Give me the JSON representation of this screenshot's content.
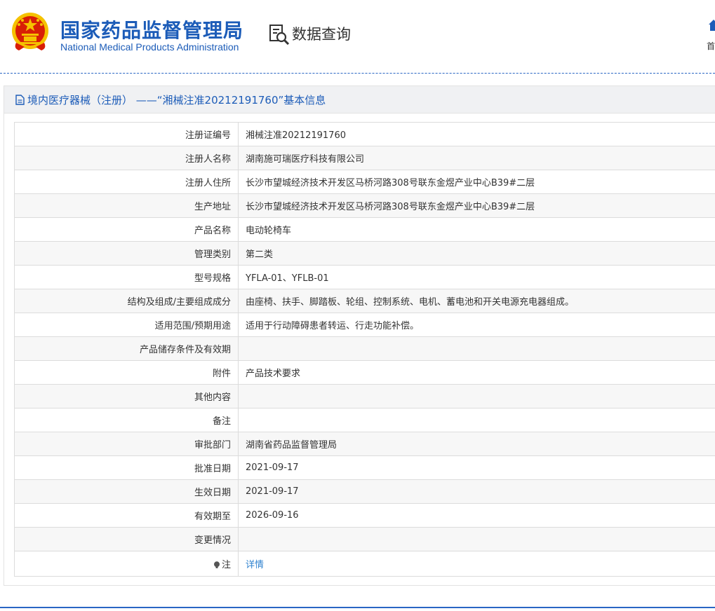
{
  "header": {
    "org_name_cn": "国家药品监督管理局",
    "org_name_en": "National Medical Products Administration",
    "data_query_label": "数据查询",
    "home_label": "首"
  },
  "panel": {
    "title": "境内医疗器械（注册） ——“湘械注准20212191760”基本信息"
  },
  "rows": [
    {
      "label": "注册证编号",
      "value": "湘械注准20212191760"
    },
    {
      "label": "注册人名称",
      "value": "湖南施可瑞医疗科技有限公司"
    },
    {
      "label": "注册人住所",
      "value": "长沙市望城经济技术开发区马桥河路308号联东金煜产业中心B39#二层"
    },
    {
      "label": "生产地址",
      "value": "长沙市望城经济技术开发区马桥河路308号联东金煜产业中心B39#二层"
    },
    {
      "label": "产品名称",
      "value": "电动轮椅车"
    },
    {
      "label": "管理类别",
      "value": "第二类"
    },
    {
      "label": "型号规格",
      "value": "YFLA-01、YFLB-01"
    },
    {
      "label": "结构及组成/主要组成成分",
      "value": "由座椅、扶手、脚踏板、轮组、控制系统、电机、蓄电池和开关电源充电器组成。"
    },
    {
      "label": "适用范围/预期用途",
      "value": "适用于行动障碍患者转运、行走功能补偿。"
    },
    {
      "label": "产品储存条件及有效期",
      "value": ""
    },
    {
      "label": "附件",
      "value": "产品技术要求"
    },
    {
      "label": "其他内容",
      "value": ""
    },
    {
      "label": "备注",
      "value": ""
    },
    {
      "label": "审批部门",
      "value": "湖南省药品监督管理局"
    },
    {
      "label": "批准日期",
      "value": "2021-09-17"
    },
    {
      "label": "生效日期",
      "value": "2021-09-17"
    },
    {
      "label": "有效期至",
      "value": "2026-09-16"
    },
    {
      "label": "变更情况",
      "value": ""
    }
  ],
  "note_row": {
    "label": "注",
    "link": "详情"
  },
  "colors": {
    "brand_blue": "#1c5cb8",
    "link_blue": "#2f82cf",
    "emblem_red": "#d81e06",
    "emblem_gold": "#f5c200"
  }
}
